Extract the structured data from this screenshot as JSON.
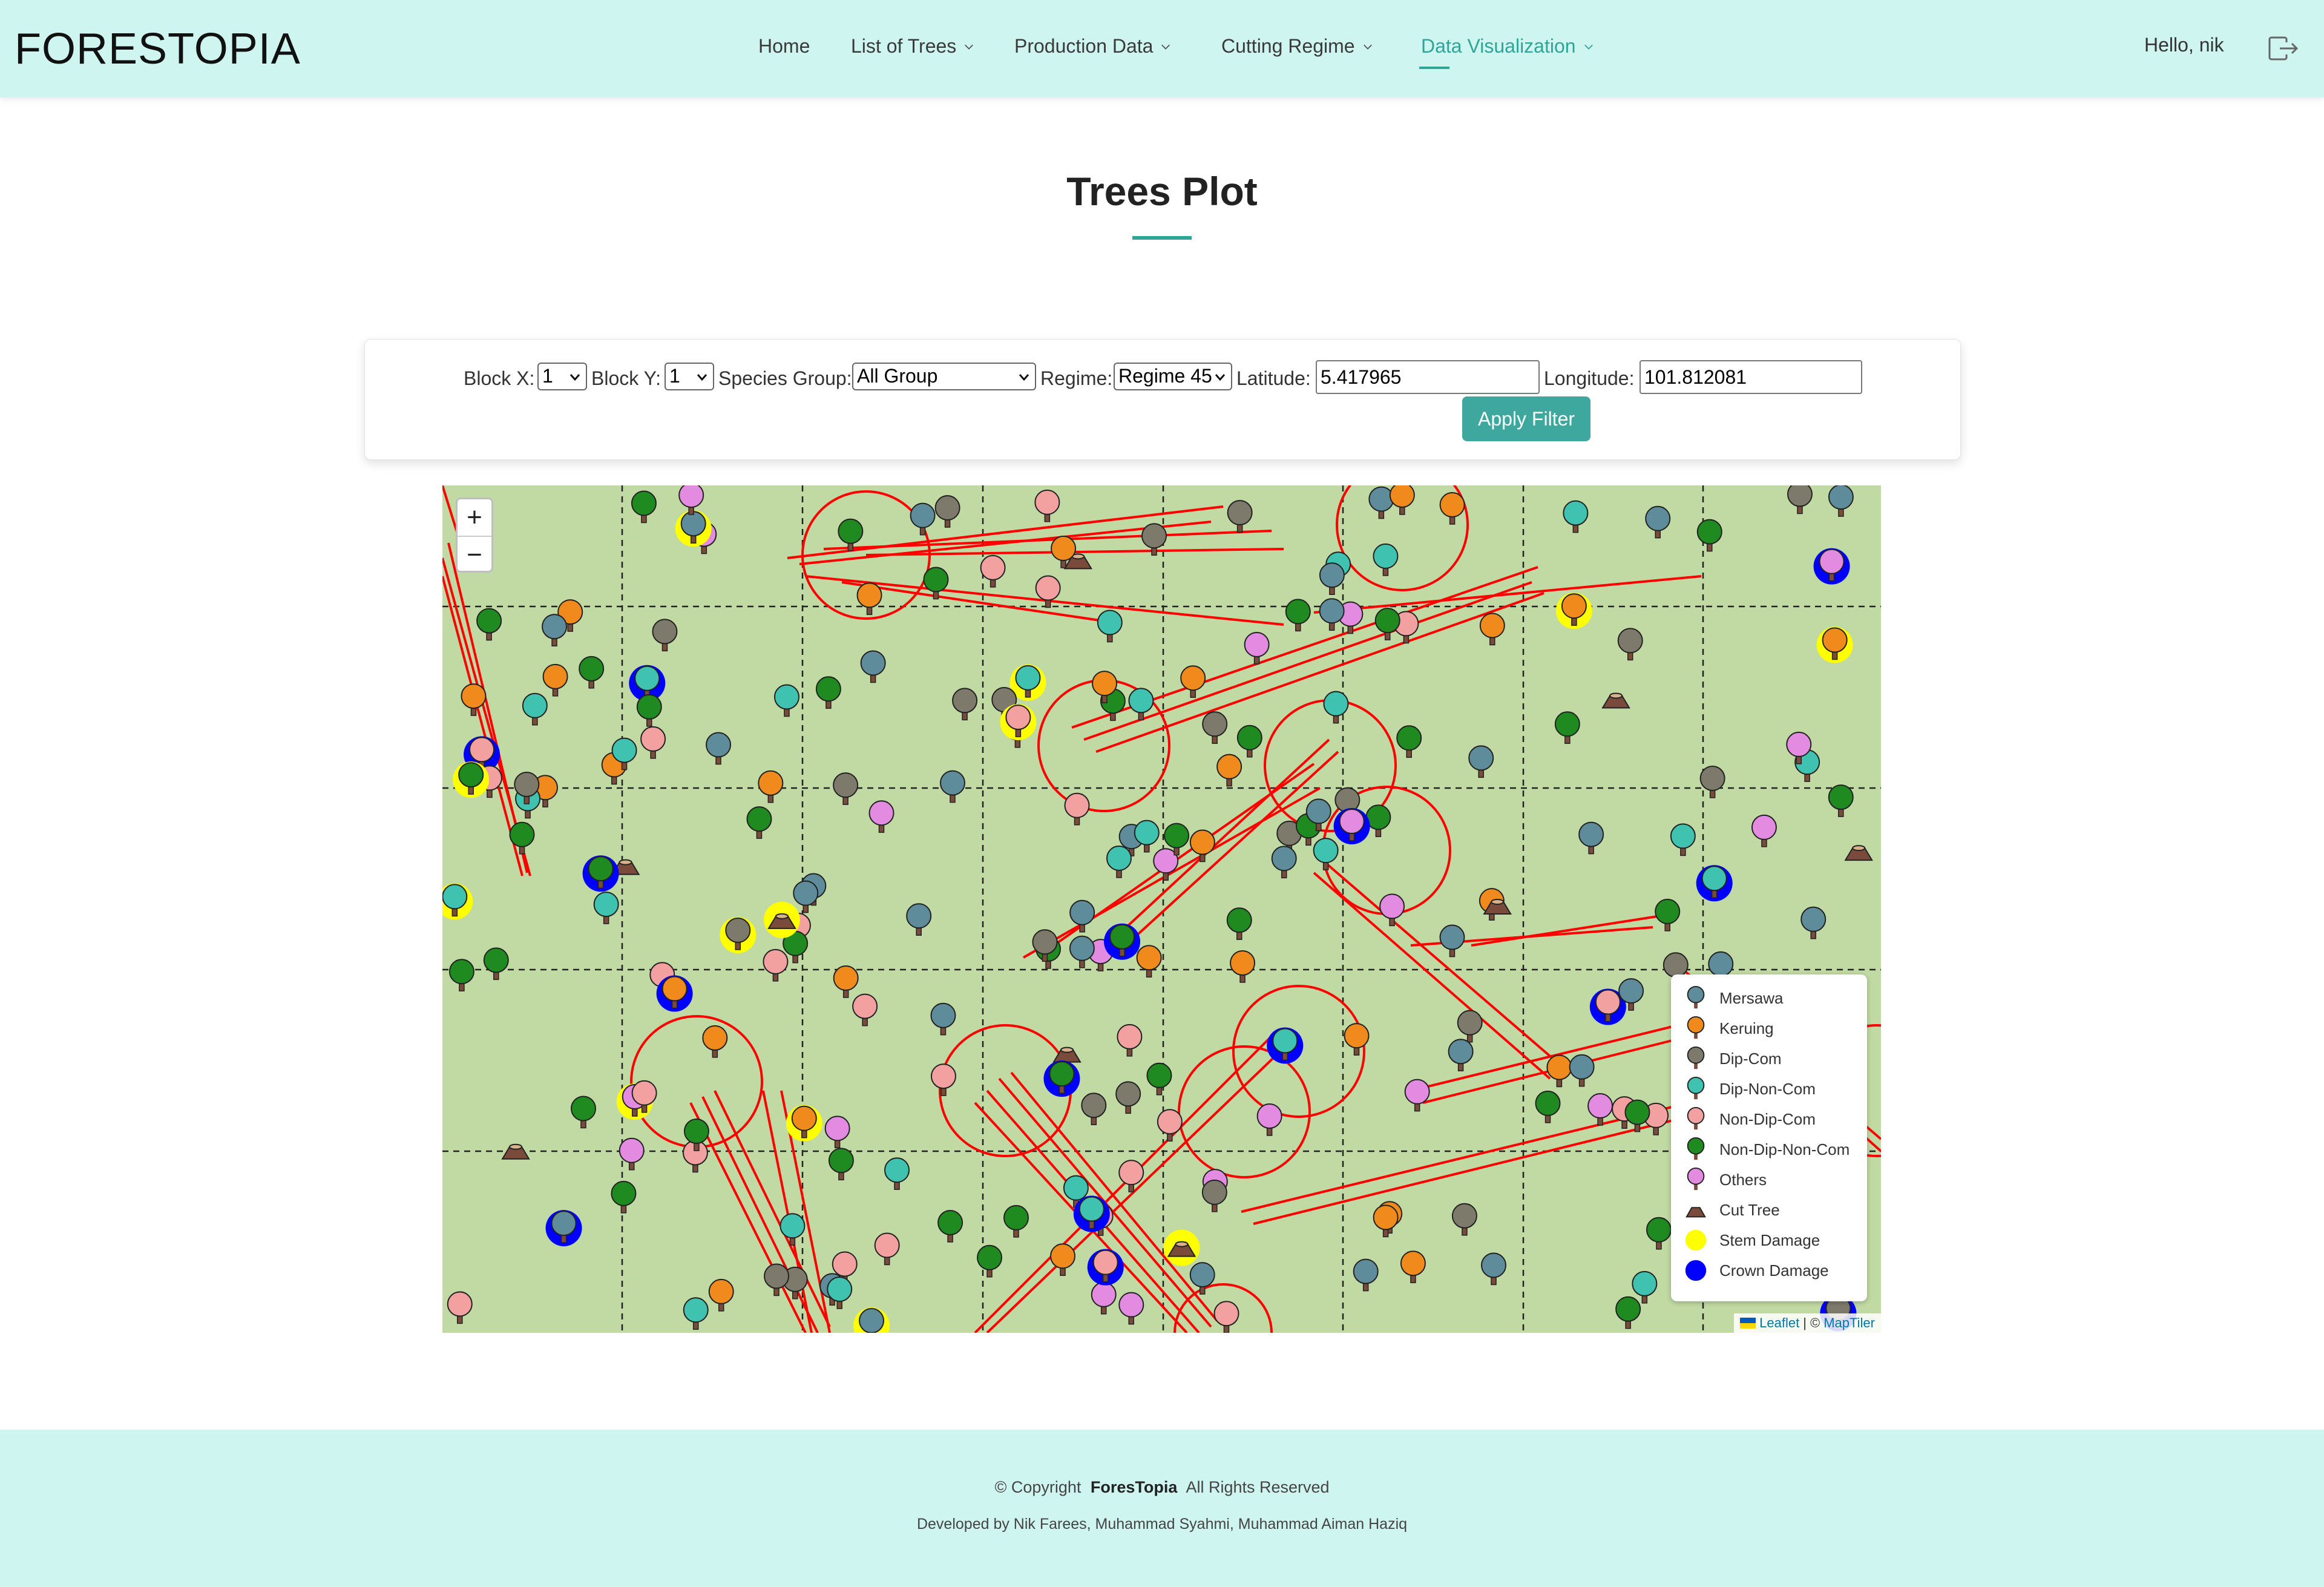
{
  "brand": {
    "logo": "FORESTOPIA"
  },
  "nav": {
    "items": [
      {
        "label": "Home",
        "has_dropdown": false,
        "active": false
      },
      {
        "label": "List of Trees",
        "has_dropdown": true,
        "active": false
      },
      {
        "label": "Production Data",
        "has_dropdown": true,
        "active": false
      },
      {
        "label": "Cutting Regime",
        "has_dropdown": true,
        "active": false
      },
      {
        "label": "Data Visualization",
        "has_dropdown": true,
        "active": true
      }
    ],
    "greeting": "Hello, nik",
    "logout_icon": "logout-icon"
  },
  "page": {
    "title": "Trees Plot"
  },
  "filters": {
    "block_x_label": "Block X:",
    "block_x_value": "1",
    "block_y_label": "Block Y:",
    "block_y_value": "1",
    "species_label": "Species Group:",
    "species_value": "All Group",
    "regime_label": "Regime:",
    "regime_value": "Regime 45",
    "latitude_label": "Latitude:",
    "latitude_value": "5.417965",
    "longitude_label": "Longitude:",
    "longitude_value": "101.812081",
    "apply_label": "Apply Filter"
  },
  "map": {
    "zoom_in": "+",
    "zoom_out": "−",
    "background_color": "#c1d9a3",
    "legend": [
      {
        "label": "Mersawa",
        "icon": "mersawa-tree-icon",
        "color": "#5e8c9a"
      },
      {
        "label": "Keruing",
        "icon": "keruing-tree-icon",
        "color": "#f08a1c"
      },
      {
        "label": "Dip-Com",
        "icon": "dip-com-tree-icon",
        "color": "#7d7a6c"
      },
      {
        "label": "Dip-Non-Com",
        "icon": "dip-non-com-tree-icon",
        "color": "#3fc3b0"
      },
      {
        "label": "Non-Dip-Com",
        "icon": "non-dip-com-tree-icon",
        "color": "#f2a0a0"
      },
      {
        "label": "Non-Dip-Non-Com",
        "icon": "non-dip-non-com-tree-icon",
        "color": "#1f8a1f"
      },
      {
        "label": "Others",
        "icon": "others-tree-icon",
        "color": "#e28be0"
      },
      {
        "label": "Cut Tree",
        "icon": "cut-tree-icon",
        "color": "#7a4a3a"
      },
      {
        "label": "Stem Damage",
        "icon": "stem-damage-marker",
        "color": "#ffff00"
      },
      {
        "label": "Crown Damage",
        "icon": "crown-damage-marker",
        "color": "#0000ff"
      }
    ],
    "attribution": {
      "leaflet": "Leaflet",
      "sep": "| ©",
      "maptiler": "MapTiler"
    }
  },
  "footer": {
    "copyright_prefix": "© Copyright",
    "brand": "ForesTopia",
    "copyright_suffix": "All Rights Reserved",
    "developers": "Developed by Nik Farees, Muhammad Syahmi, Muhammad Aiman Haziq"
  }
}
